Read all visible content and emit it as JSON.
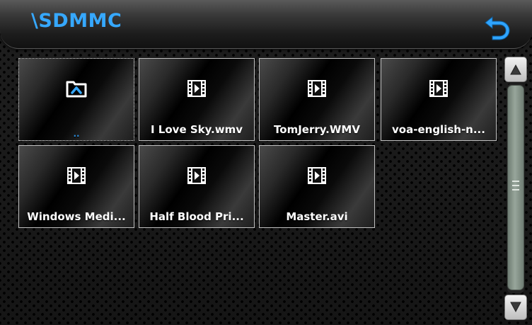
{
  "header": {
    "path": "\\SDMMC",
    "back_icon": "back-arrow-icon",
    "accent_color": "#36a8ff"
  },
  "files": [
    {
      "name": "..",
      "type": "parent-folder",
      "icon": "folder-up-icon",
      "selected": true
    },
    {
      "name": "I Love Sky.wmv",
      "type": "video",
      "icon": "video-file-icon"
    },
    {
      "name": "TomJerry.WMV",
      "type": "video",
      "icon": "video-file-icon"
    },
    {
      "name": "voa-english-n...",
      "type": "video",
      "icon": "video-file-icon"
    },
    {
      "name": "Windows Medi...",
      "type": "video",
      "icon": "video-file-icon"
    },
    {
      "name": "Half Blood Pri...",
      "type": "video",
      "icon": "video-file-icon"
    },
    {
      "name": "Master.avi",
      "type": "video",
      "icon": "video-file-icon"
    }
  ],
  "scrollbar": {
    "up_icon": "scroll-up-arrow-icon",
    "down_icon": "scroll-down-arrow-icon",
    "grip_icon": "grip-icon"
  }
}
